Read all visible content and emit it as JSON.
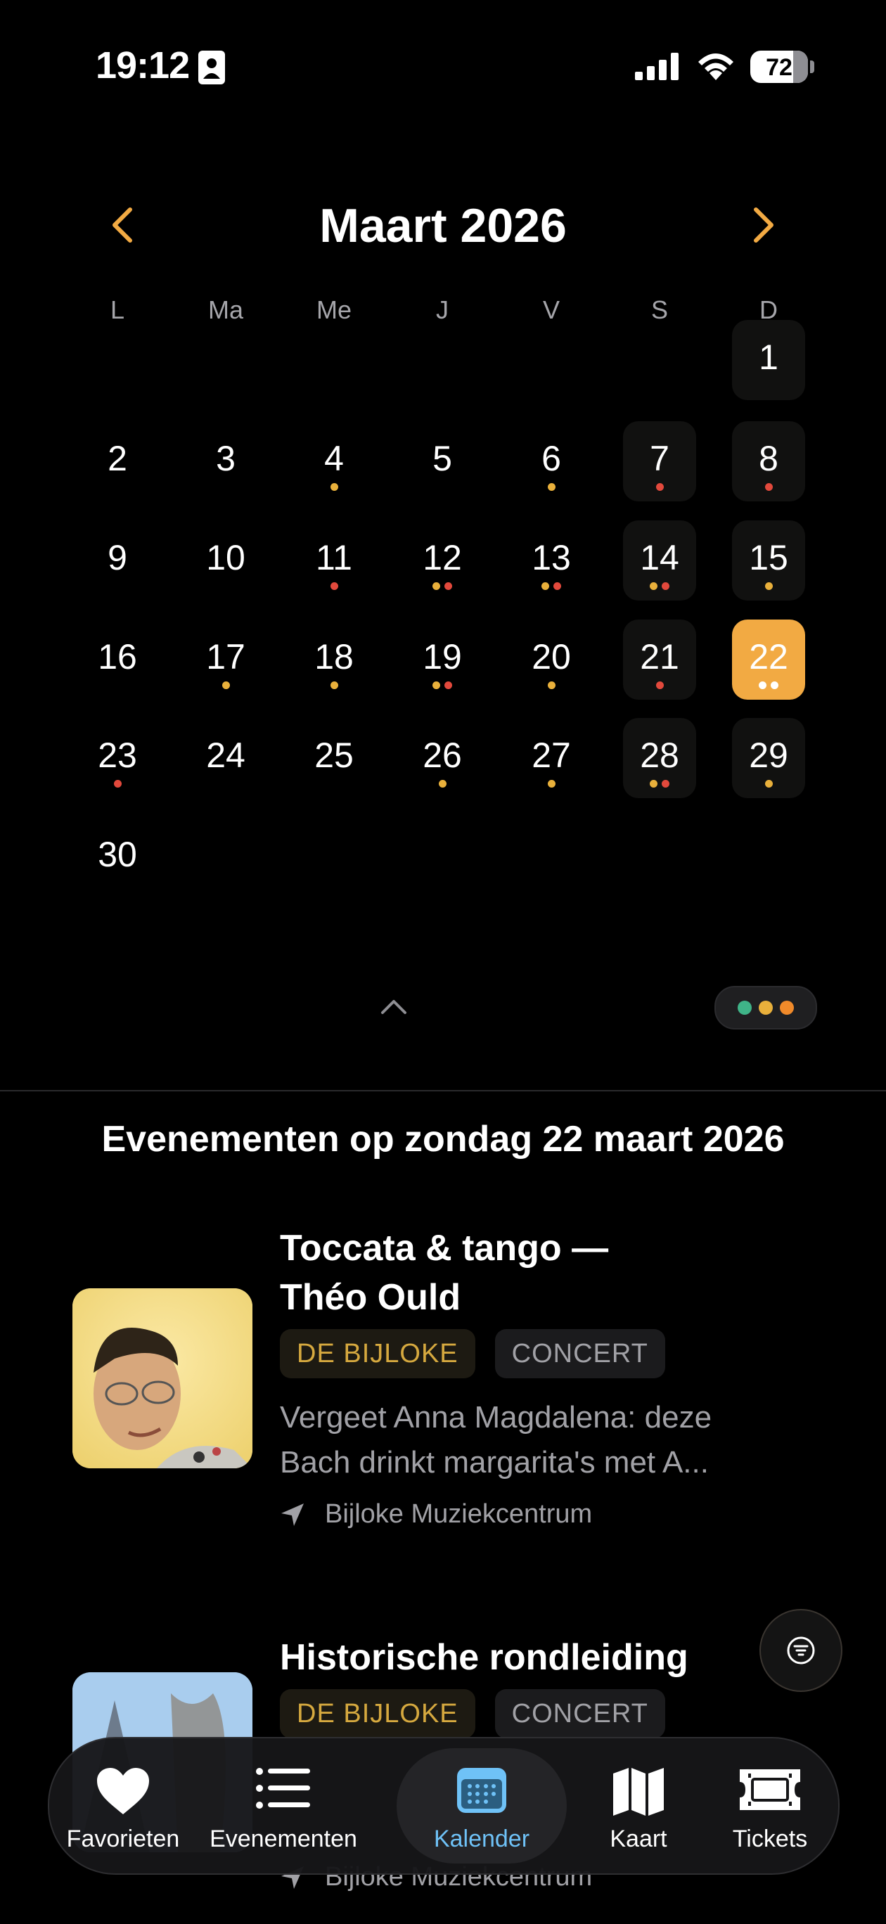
{
  "status_bar": {
    "time": "19:12",
    "battery": "72"
  },
  "calendar": {
    "month_title": "Maart 2026",
    "weekdays": [
      "L",
      "Ma",
      "Me",
      "J",
      "V",
      "S",
      "D"
    ],
    "colors": {
      "yellow": "#e9b03b",
      "red": "#e2493c",
      "green": "#3fb488",
      "orange": "#f08a2a",
      "selected": "#f2aa43"
    },
    "days": [
      {
        "n": "1",
        "row": 0,
        "col": 6,
        "bg": true,
        "dots": []
      },
      {
        "n": "2",
        "row": 1,
        "col": 0,
        "dots": []
      },
      {
        "n": "3",
        "row": 1,
        "col": 1,
        "dots": []
      },
      {
        "n": "4",
        "row": 1,
        "col": 2,
        "dots": [
          "yellow"
        ]
      },
      {
        "n": "5",
        "row": 1,
        "col": 3,
        "dots": []
      },
      {
        "n": "6",
        "row": 1,
        "col": 4,
        "dots": [
          "yellow"
        ]
      },
      {
        "n": "7",
        "row": 1,
        "col": 5,
        "bg": true,
        "dots": [
          "red"
        ]
      },
      {
        "n": "8",
        "row": 1,
        "col": 6,
        "bg": true,
        "dots": [
          "red"
        ]
      },
      {
        "n": "9",
        "row": 2,
        "col": 0,
        "dots": []
      },
      {
        "n": "10",
        "row": 2,
        "col": 1,
        "dots": []
      },
      {
        "n": "11",
        "row": 2,
        "col": 2,
        "dots": [
          "red"
        ]
      },
      {
        "n": "12",
        "row": 2,
        "col": 3,
        "dots": [
          "yellow",
          "red"
        ]
      },
      {
        "n": "13",
        "row": 2,
        "col": 4,
        "dots": [
          "yellow",
          "red"
        ]
      },
      {
        "n": "14",
        "row": 2,
        "col": 5,
        "bg": true,
        "dots": [
          "yellow",
          "red"
        ]
      },
      {
        "n": "15",
        "row": 2,
        "col": 6,
        "bg": true,
        "dots": [
          "yellow"
        ]
      },
      {
        "n": "16",
        "row": 3,
        "col": 0,
        "dots": []
      },
      {
        "n": "17",
        "row": 3,
        "col": 1,
        "dots": [
          "yellow"
        ]
      },
      {
        "n": "18",
        "row": 3,
        "col": 2,
        "dots": [
          "yellow"
        ]
      },
      {
        "n": "19",
        "row": 3,
        "col": 3,
        "dots": [
          "yellow",
          "red"
        ]
      },
      {
        "n": "20",
        "row": 3,
        "col": 4,
        "dots": [
          "yellow"
        ]
      },
      {
        "n": "21",
        "row": 3,
        "col": 5,
        "bg": true,
        "dots": [
          "red"
        ]
      },
      {
        "n": "22",
        "row": 3,
        "col": 6,
        "selected": true,
        "dots": [
          "white",
          "white"
        ]
      },
      {
        "n": "23",
        "row": 4,
        "col": 0,
        "dots": [
          "red"
        ]
      },
      {
        "n": "24",
        "row": 4,
        "col": 1,
        "dots": []
      },
      {
        "n": "25",
        "row": 4,
        "col": 2,
        "dots": []
      },
      {
        "n": "26",
        "row": 4,
        "col": 3,
        "dots": [
          "yellow"
        ]
      },
      {
        "n": "27",
        "row": 4,
        "col": 4,
        "dots": [
          "yellow"
        ]
      },
      {
        "n": "28",
        "row": 4,
        "col": 5,
        "bg": true,
        "dots": [
          "yellow",
          "red"
        ]
      },
      {
        "n": "29",
        "row": 4,
        "col": 6,
        "bg": true,
        "dots": [
          "yellow"
        ]
      },
      {
        "n": "30",
        "row": 5,
        "col": 0,
        "dots": []
      }
    ]
  },
  "events_heading": "Evenementen op zondag 22 maart 2026",
  "events": [
    {
      "title_line1": "Toccata & tango —",
      "title_line2": "Théo Ould",
      "venue_tag": "DE BIJLOKE",
      "category_tag": "CONCERT",
      "desc_line1": "Vergeet Anna Magdalena: deze",
      "desc_line2": "Bach drinkt margarita's met A...",
      "location": "Bijloke Muziekcentrum"
    },
    {
      "title_line1": "Historische rondleiding",
      "venue_tag": "DE BIJLOKE",
      "category_tag": "CONCERT",
      "location": "Bijloke Muziekcentrum"
    }
  ],
  "tab_bar": {
    "favorites": "Favorieten",
    "events": "Evenementen",
    "calendar": "Kalender",
    "map": "Kaart",
    "tickets": "Tickets"
  }
}
